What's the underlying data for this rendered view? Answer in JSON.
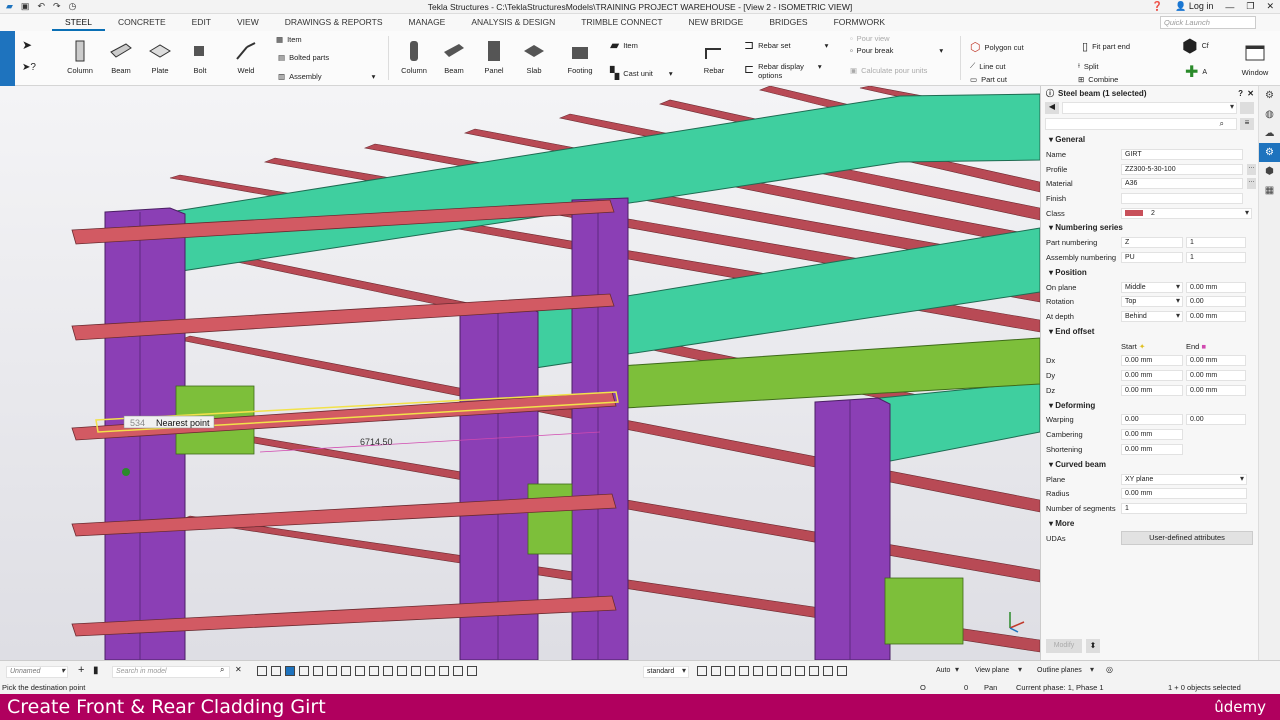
{
  "titlebar": {
    "title": "Tekla Structures - C:\\TeklaStructuresModels\\TRAINING PROJECT WAREHOUSE - [View 2 - ISOMETRIC VIEW]",
    "login": "Log in"
  },
  "tabs": [
    "STEEL",
    "CONCRETE",
    "EDIT",
    "VIEW",
    "DRAWINGS & REPORTS",
    "MANAGE",
    "ANALYSIS & DESIGN",
    "TRIMBLE CONNECT",
    "NEW BRIDGE",
    "BRIDGES",
    "FORMWORK"
  ],
  "quick_launch_placeholder": "Quick Launch",
  "ribbon": {
    "column": "Column",
    "beam": "Beam",
    "plate": "Plate",
    "bolt": "Bolt",
    "weld": "Weld",
    "item": "Item",
    "bolted_parts": "Bolted parts",
    "assembly": "Assembly",
    "c_column": "Column",
    "c_beam": "Beam",
    "panel": "Panel",
    "slab": "Slab",
    "footing": "Footing",
    "c_item": "Item",
    "cast_unit": "Cast unit",
    "rebar": "Rebar",
    "rebar_set": "Rebar set",
    "rebar_display_1": "Rebar display",
    "rebar_display_2": "options",
    "pour_view": "Pour view",
    "pour_break": "Pour break",
    "calc_pour": "Calculate pour units",
    "polygon_cut": "Polygon cut",
    "line_cut": "Line cut",
    "part_cut": "Part cut",
    "fit_part_end": "Fit part end",
    "split": "Split",
    "combine": "Combine",
    "window": "Window"
  },
  "viewport": {
    "snap_label": "Nearest point",
    "dimension": "6714.50",
    "snap_prefix": "534"
  },
  "panel": {
    "title": "Steel beam (1 selected)",
    "general": "General",
    "name_label": "Name",
    "name": "GIRT",
    "profile_label": "Profile",
    "profile": "ZZ300-5-30-100",
    "material_label": "Material",
    "material": "A36",
    "finish_label": "Finish",
    "finish": "",
    "class_label": "Class",
    "class": "2",
    "numbering": "Numbering series",
    "part_numbering_label": "Part numbering",
    "part_prefix": "Z",
    "part_start": "1",
    "assembly_numbering_label": "Assembly numbering",
    "asm_prefix": "PU",
    "asm_start": "1",
    "position": "Position",
    "on_plane_label": "On plane",
    "on_plane": "Middle",
    "on_plane_val": "0.00 mm",
    "rotation_label": "Rotation",
    "rotation": "Top",
    "rotation_val": "0.00",
    "at_depth_label": "At depth",
    "at_depth": "Behind",
    "at_depth_val": "0.00 mm",
    "end_offset": "End offset",
    "start": "Start",
    "end": "End",
    "dx_label": "Dx",
    "dx_start": "0.00 mm",
    "dx_end": "0.00 mm",
    "dy_label": "Dy",
    "dy_start": "0.00 mm",
    "dy_end": "0.00 mm",
    "dz_label": "Dz",
    "dz_start": "0.00 mm",
    "dz_end": "0.00 mm",
    "deforming": "Deforming",
    "warping_label": "Warping",
    "warping_start": "0.00",
    "warping_end": "0.00",
    "cambering_label": "Cambering",
    "cambering": "0.00 mm",
    "shortening_label": "Shortening",
    "shortening": "0.00 mm",
    "curved_beam": "Curved beam",
    "plane_label": "Plane",
    "plane": "XY plane",
    "radius_label": "Radius",
    "radius": "0.00 mm",
    "segments_label": "Number of segments",
    "segments": "1",
    "more": "More",
    "udas_label": "UDAs",
    "udas_button": "User-defined attributes",
    "modify_button": "Modify"
  },
  "bottombar": {
    "unnamed": "Unnamed",
    "search_placeholder": "Search in model",
    "standard": "standard",
    "auto": "Auto",
    "view_plane": "View plane",
    "outline_planes": "Outline planes"
  },
  "status": {
    "message": "Pick the destination point",
    "o": "O",
    "zero": "0",
    "pan": "Pan",
    "phase": "Current phase: 1, Phase 1",
    "selected": "1 + 0 objects selected"
  },
  "banner": {
    "title": "Create Front & Rear Cladding Girt",
    "brand": "ûdemy"
  },
  "colors": {
    "accent": "#1e73be",
    "banner": "#b0005e",
    "column": "#8b3fb5",
    "girt": "#c8505a",
    "rafter": "#3ec9a0",
    "beam": "#7dbf3a"
  }
}
